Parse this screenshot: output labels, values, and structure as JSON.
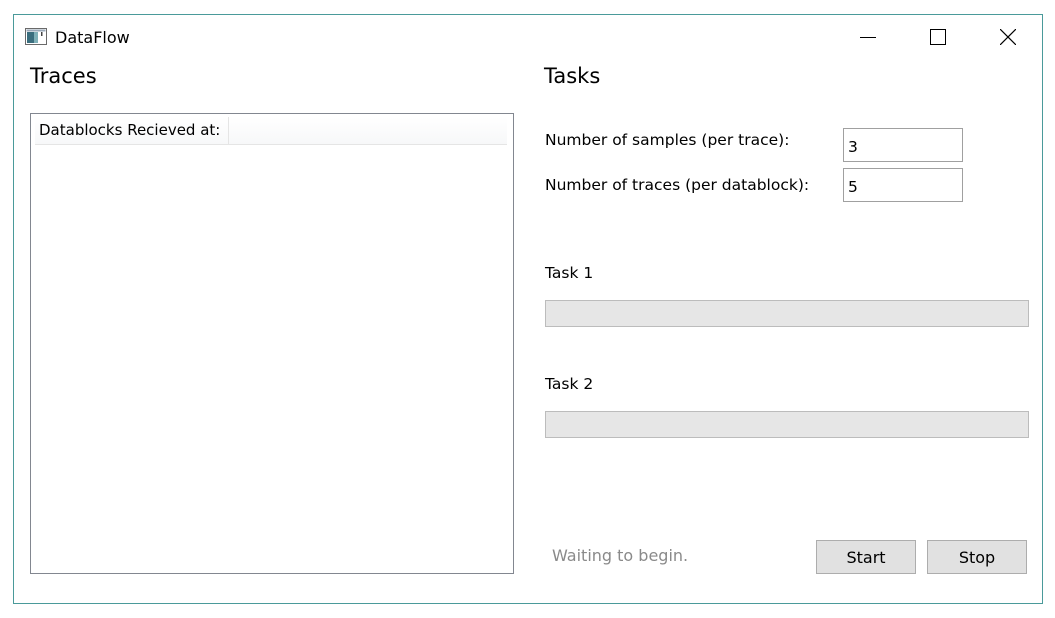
{
  "window": {
    "title": "DataFlow",
    "icon": "app-window-icon",
    "controls": [
      "minimize-icon",
      "maximize-icon",
      "close-icon"
    ]
  },
  "traces": {
    "title": "Traces",
    "columns": [
      "Datablocks Recieved at:",
      ""
    ],
    "rows": []
  },
  "tasks": {
    "title": "Tasks",
    "samples_label": "Number of samples (per trace):",
    "samples_value": "3",
    "traces_label": "Number of traces (per datablock):",
    "traces_value": "5",
    "task1": {
      "label": "Task 1",
      "progress": 0
    },
    "task2": {
      "label": "Task 2",
      "progress": 0
    }
  },
  "status": "Waiting to begin.",
  "buttons": {
    "start": "Start",
    "stop": "Stop"
  },
  "colors": {
    "window_border": "#4a9a9a",
    "progress_track": "#e6e6e6",
    "progress_fill": "#06b025",
    "status_text": "#8a8a8a"
  }
}
